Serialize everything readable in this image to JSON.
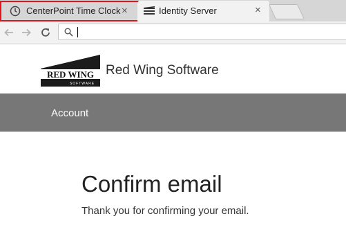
{
  "browser": {
    "tabs": [
      {
        "title": "CenterPoint Time Clock",
        "icon": "clock-icon",
        "close": "×"
      },
      {
        "title": "Identity Server",
        "icon": "identity-server-logo-icon",
        "close": "×"
      }
    ],
    "address_bar": {
      "value": "",
      "icon": "search-icon"
    }
  },
  "site": {
    "logo": {
      "text": "RED WING",
      "subtext": "SOFTWARE"
    },
    "brand_name": "Red Wing Software",
    "nav": [
      {
        "label": "Account"
      }
    ]
  },
  "main": {
    "heading": "Confirm email",
    "message": "Thank you for confirming your email."
  },
  "colors": {
    "highlight": "#e0141b",
    "navbar": "#777777"
  }
}
